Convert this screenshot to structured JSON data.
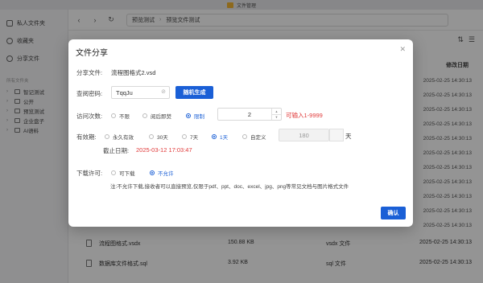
{
  "window": {
    "title": "文件管理"
  },
  "sidebar": {
    "items": [
      {
        "label": "私人文件夹",
        "icon": "user-folder-icon"
      },
      {
        "label": "收藏夹",
        "icon": "star-icon"
      },
      {
        "label": "分享文件",
        "icon": "share-icon"
      }
    ],
    "section_label": "所有文件夹",
    "folders": [
      "智记测试",
      "公开",
      "预览测试",
      "企业盘子",
      "AI语料"
    ]
  },
  "toolbar": {
    "path": [
      "预览测试",
      "预览文件测试"
    ]
  },
  "filelist": {
    "header_date": "修改日期",
    "background_dates": [
      "2025-02-25 14:30:13",
      "2025-02-25 14:30:13",
      "2025-02-25 14:30:13",
      "2025-02-25 14:30:13",
      "2025-02-25 14:30:13",
      "2025-02-25 14:30:13",
      "2025-02-25 14:30:13",
      "2025-02-25 14:30:13",
      "2025-02-25 14:30:13",
      "2025-02-25 14:30:13",
      "2025-02-25 14:30:13"
    ],
    "rows": [
      {
        "name": "流程图格式.vsdx",
        "size": "150.88 KB",
        "type": "vsdx 文件",
        "date": "2025-02-25 14:30:13"
      },
      {
        "name": "数据库文件格式.sql",
        "size": "3.92 KB",
        "type": "sql 文件",
        "date": "2025-02-25 14:30:13"
      }
    ]
  },
  "dialog": {
    "title": "文件分享",
    "share_file_label": "分享文件:",
    "share_file_value": "流程图格式2.vsd",
    "password_label": "查阅密码:",
    "password_value": "TqqJu",
    "random_button": "随机生成",
    "visits_label": "访问次数:",
    "visits_options": [
      "不限",
      "阅后即焚",
      "限制"
    ],
    "visits_selected": 2,
    "visits_value": "2",
    "visits_hint": "可输入1-9999",
    "validity_label": "有效期:",
    "validity_options": [
      "永久有效",
      "30天",
      "7天",
      "1天",
      "自定义"
    ],
    "validity_selected": 3,
    "custom_days_value": "180",
    "custom_days_unit": "天",
    "expire_label": "截止日期:",
    "expire_value": "2025-03-12 17:03:47",
    "download_label": "下载许可:",
    "download_options": [
      "可下载",
      "不允许"
    ],
    "download_selected": 1,
    "note": "注:不允许下载,接收者可以直接预览,仅限于pdf、ppt、doc、excel、jpg、png等常见文档与图片格式文件",
    "confirm_button": "确认"
  },
  "colors": {
    "primary": "#1a5fd6",
    "hint_red": "#e03a3a",
    "overlay": "rgba(0,0,0,0.42)"
  }
}
